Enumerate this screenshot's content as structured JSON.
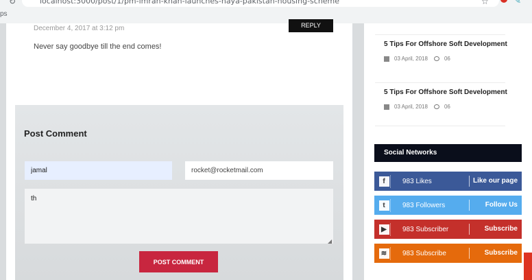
{
  "browser": {
    "url": "localhost:3000/post/1/pm-imran-khan-launches-naya-pakistan-housing-scheme",
    "bookmarks_label": "ps"
  },
  "comment": {
    "date": "December 4, 2017 at 3:12 pm",
    "text": "Never say goodbye till the end comes!",
    "reply_label": "REPLY"
  },
  "post_comment": {
    "title": "Post Comment",
    "name_value": "jamal",
    "email_value": "rocket@rocketmail.com",
    "message_value": "th",
    "submit_label": "POST COMMENT"
  },
  "sidebar": {
    "posts": [
      {
        "title": "5 Tips For Offshore Soft Development",
        "date": "03 April, 2018",
        "comments": "06"
      },
      {
        "title": "5 Tips For Offshore Soft Development",
        "date": "03 April, 2018",
        "comments": "06"
      }
    ],
    "social_heading": "Social Networks",
    "social": [
      {
        "icon": "facebook-icon",
        "glyph": "f",
        "count": "983 Likes",
        "label": "Like our page",
        "color": "#3b5998"
      },
      {
        "icon": "twitter-icon",
        "glyph": "t",
        "count": "983 Followers",
        "label": "Follow Us",
        "color": "#55acee"
      },
      {
        "icon": "youtube-icon",
        "glyph": "▶",
        "count": "983 Subscriber",
        "label": "Subscribe",
        "color": "#c4302b"
      },
      {
        "icon": "rss-icon",
        "glyph": "≋",
        "count": "983 Subscribe",
        "label": "Subscribe",
        "color": "#e56a0c"
      }
    ]
  }
}
